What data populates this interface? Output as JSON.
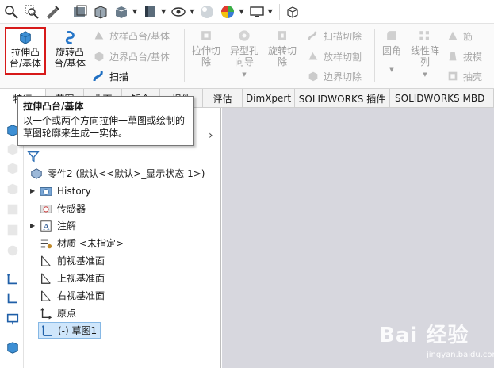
{
  "toolbar": {
    "icons": [
      "zoom-fit-icon",
      "zoom-area-icon",
      "previous-view-icon",
      "section-view-icon",
      "view-orientation-icon",
      "display-style-icon",
      "hide-show-icon",
      "edit-appearance-icon",
      "apply-scene-icon",
      "view-settings-icon",
      "3d-view-icon"
    ]
  },
  "ribbon": {
    "extrude_boss": "拉伸凸\n台/基体",
    "revolve_boss": "旋转凸\n台/基体",
    "swept_boss": "放样凸台/基体",
    "boundary_boss": "边界凸台/基体",
    "sweep": "扫描",
    "extrude_cut": "拉伸切\n除",
    "hole_wizard": "异型孔\n向导",
    "revolve_cut": "旋转切\n除",
    "sweep_cut": "扫描切除",
    "loft_cut": "放样切割",
    "boundary_cut": "边界切除",
    "fillet": "圆角",
    "linear_pattern": "线性阵\n列",
    "rib": "筋",
    "draft": "拔模",
    "shell": "抽壳"
  },
  "tabs": [
    "特征",
    "草图",
    "曲面",
    "钣金",
    "焊件",
    "评估",
    "DimXpert",
    "SOLIDWORKS 插件",
    "SOLIDWORKS MBD"
  ],
  "tooltip": {
    "title": "拉伸凸台/基体",
    "body": "以一个或两个方向拉伸一草图或绘制的草图轮廓来生成一实体。"
  },
  "tree": {
    "root": "零件2 (默认<<默认>_显示状态 1>)",
    "items": [
      {
        "label": "History",
        "icon": "history-folder-icon",
        "expandable": true
      },
      {
        "label": "传感器",
        "icon": "sensor-icon",
        "expandable": false
      },
      {
        "label": "注解",
        "icon": "annotation-icon",
        "expandable": true
      },
      {
        "label": "材质 <未指定>",
        "icon": "material-icon",
        "expandable": false
      },
      {
        "label": "前视基准面",
        "icon": "plane-icon",
        "expandable": false
      },
      {
        "label": "上视基准面",
        "icon": "plane-icon",
        "expandable": false
      },
      {
        "label": "右视基准面",
        "icon": "plane-icon",
        "expandable": false
      },
      {
        "label": "原点",
        "icon": "origin-icon",
        "expandable": false
      },
      {
        "label": "(-) 草图1",
        "icon": "sketch-icon",
        "expandable": false
      }
    ]
  },
  "watermark": {
    "logo": "Bai 经验",
    "url": "jingyan.baidu.com"
  },
  "colors": {
    "selection_outline": "#d71a1a",
    "viewport_bg": "#d7d7de",
    "highlight_bg": "#cfe6fb"
  }
}
